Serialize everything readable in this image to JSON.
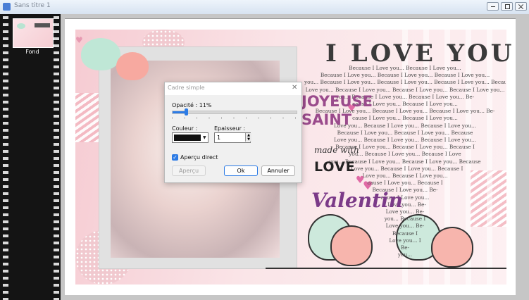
{
  "window": {
    "title": "Sans titre 1"
  },
  "layers": [
    {
      "name": "Fond"
    }
  ],
  "artwork": {
    "title": "I LOVE YOU",
    "repeated_lines": [
      "Because I Love you... Because I Love you...",
      "Because I Love you... Because I Love you... Because I Love you...",
      "you... Because I Love you... Because I Love you... Because I Love you... Because I",
      "Love you... Because I Love you... Because I Love you... Because I Love you...",
      "you... Because I Love you... Because I Love you... Be-",
      "cause I Love you... Because I Love you...",
      "Because I Love you... Because I Love you... Because I Love you... Be-",
      "cause I Love you... Because I Love you...",
      "Love you... Because I Love you... Because I Love you...",
      "Because I Love you... Because I Love you... Because",
      "Love you... Because I Love you... Because I Love you...",
      "Because I Love you... Because I Love you... Because I",
      "you... Because I Love you... Because I Love",
      "you... Because I Love you... Because I Love you... Because",
      "I Love you... Because I Love you... Because I",
      "Love you... Because I Love you...",
      "cause I Love you... Because I",
      "Because I Love you... Be-",
      "cause I Love you...",
      "I Love you... Be-",
      "Love you... Be-",
      "you... Because I",
      "Love you... Be-",
      "Because I",
      "Love you... I",
      "Be-",
      "you..."
    ],
    "joyeuse_line1": "JOYEUSE",
    "joyeuse_line2": "SAINT",
    "made_with": "made with",
    "love": "LOVE",
    "valentin": "Valentin"
  },
  "dialog": {
    "title": "Cadre simple",
    "opacity_label": "Opacité : 11%",
    "opacity_value": 0.11,
    "color_label": "Couleur :",
    "color_value": "#111111",
    "thickness_label": "Epaisseur :",
    "thickness_value": "1",
    "live_preview_label": "Aperçu direct",
    "live_preview_checked": true,
    "preview_button": "Aperçu",
    "ok_button": "Ok",
    "cancel_button": "Annuler"
  },
  "colors": {
    "accent": "#2c7be5",
    "title_text": "#3a3a3a",
    "purple": "#7b3a88",
    "pink_background": "#f7d8dd"
  }
}
